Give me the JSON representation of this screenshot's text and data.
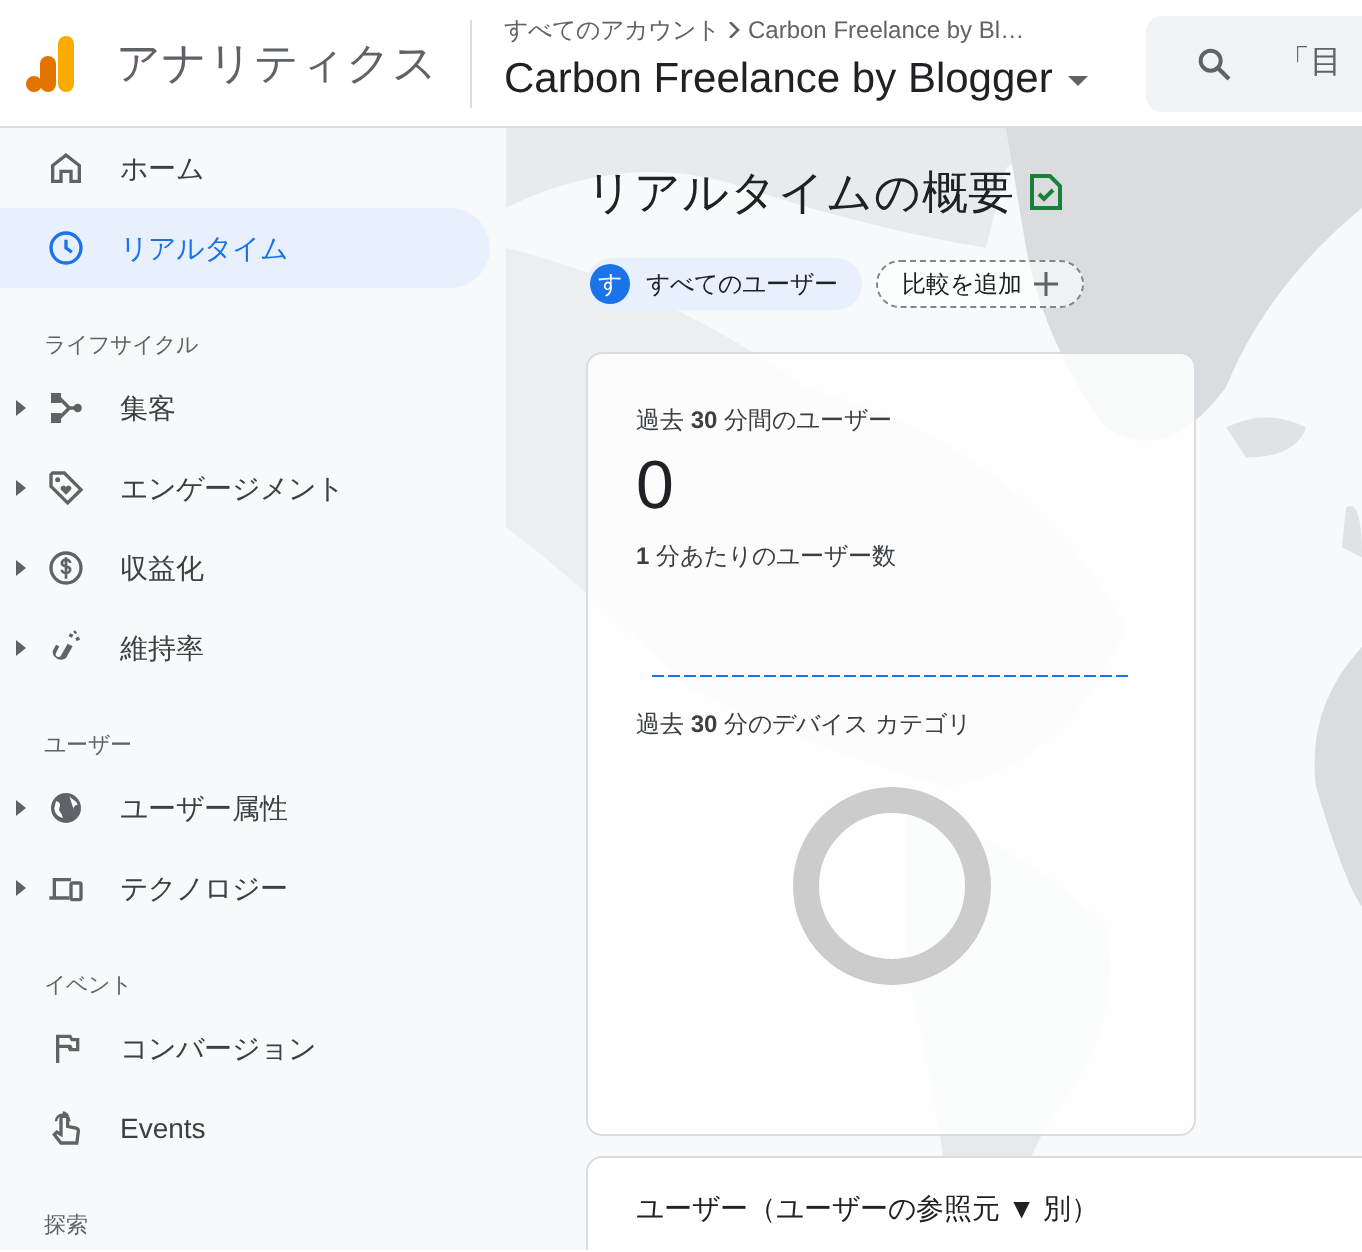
{
  "header": {
    "product": "アナリティクス",
    "breadcrumb": [
      "すべてのアカウント",
      "Carbon Freelance by Bl…"
    ],
    "property": "Carbon Freelance by Blogger",
    "search": {
      "placeholder": "「目"
    }
  },
  "sidebar": {
    "items": [
      {
        "kind": "item",
        "label": "ホーム",
        "selected": false,
        "expandable": false
      },
      {
        "kind": "item",
        "label": "リアルタイム",
        "selected": true,
        "expandable": false
      },
      {
        "kind": "section",
        "label": "ライフサイクル"
      },
      {
        "kind": "item",
        "label": "集客",
        "selected": false,
        "expandable": true
      },
      {
        "kind": "item",
        "label": "エンゲージメント",
        "selected": false,
        "expandable": true
      },
      {
        "kind": "item",
        "label": "収益化",
        "selected": false,
        "expandable": true
      },
      {
        "kind": "item",
        "label": "維持率",
        "selected": false,
        "expandable": true
      },
      {
        "kind": "section",
        "label": "ユーザー"
      },
      {
        "kind": "item",
        "label": "ユーザー属性",
        "selected": false,
        "expandable": true
      },
      {
        "kind": "item",
        "label": "テクノロジー",
        "selected": false,
        "expandable": true
      },
      {
        "kind": "section",
        "label": "イベント"
      },
      {
        "kind": "item",
        "label": "コンバージョン",
        "selected": false,
        "expandable": false
      },
      {
        "kind": "item",
        "label": "Events",
        "selected": false,
        "expandable": false
      },
      {
        "kind": "section",
        "label": "探索"
      }
    ]
  },
  "main": {
    "title": "リアルタイムの概要",
    "chips": [
      {
        "kind": "segment",
        "avatar": "す",
        "label": "すべてのユーザー"
      },
      {
        "kind": "add",
        "label": "比較を追加"
      }
    ],
    "users_card": {
      "title": "過去 **30** 分間のユーザー",
      "value": "0",
      "subtitle": "**1** 分あたりのユーザー数",
      "device_title": "過去 **30** 分のデバイス カテゴリ"
    },
    "source_card": {
      "title": "ユーザー（ユーザーの参照元 ▼ 別）"
    }
  }
}
